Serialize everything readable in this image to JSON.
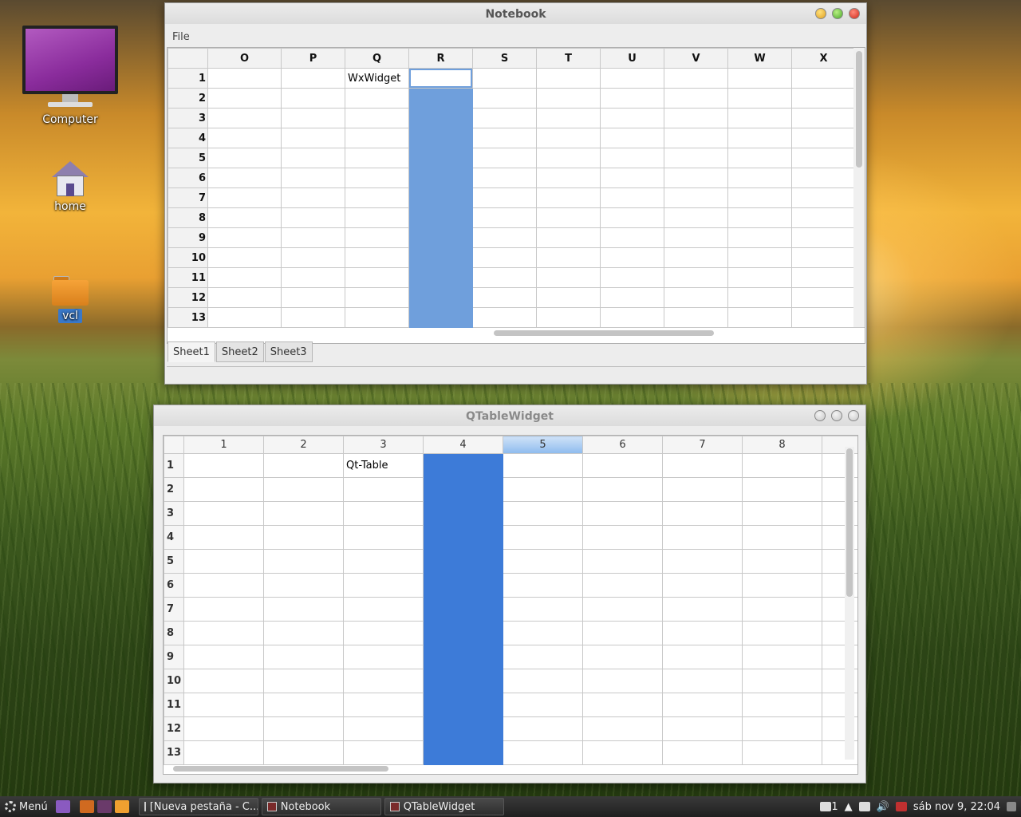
{
  "desktop": {
    "icons": [
      {
        "label": "Computer"
      },
      {
        "label": "home"
      },
      {
        "label": "vcl"
      }
    ]
  },
  "notebook": {
    "title": "Notebook",
    "menu": {
      "file": "File"
    },
    "columns": [
      "O",
      "P",
      "Q",
      "R",
      "S",
      "T",
      "U",
      "V",
      "W",
      "X"
    ],
    "rows": [
      "1",
      "2",
      "3",
      "4",
      "5",
      "6",
      "7",
      "8",
      "9",
      "10",
      "11",
      "12",
      "13"
    ],
    "cell_q1": "WxWidget",
    "selected_column": "R",
    "tabs": [
      "Sheet1",
      "Sheet2",
      "Sheet3"
    ],
    "active_tab": "Sheet1"
  },
  "qtable": {
    "title": "QTableWidget",
    "columns": [
      "1",
      "2",
      "3",
      "4",
      "5",
      "6",
      "7",
      "8"
    ],
    "rows": [
      "1",
      "2",
      "3",
      "4",
      "5",
      "6",
      "7",
      "8",
      "9",
      "10",
      "11",
      "12",
      "13"
    ],
    "cell_3_1": "Qt-Table",
    "selected_column": "4",
    "highlighted_header": "5"
  },
  "taskbar": {
    "menu_label": "Menú",
    "tasks": [
      "[Nueva pestaña - C...",
      "Notebook",
      "QTableWidget"
    ],
    "notifications": "1",
    "clock": "sáb nov  9, 22:04"
  },
  "colors": {
    "wx_selection": "#6f9fdc",
    "qt_selection": "#3d7bd8"
  }
}
